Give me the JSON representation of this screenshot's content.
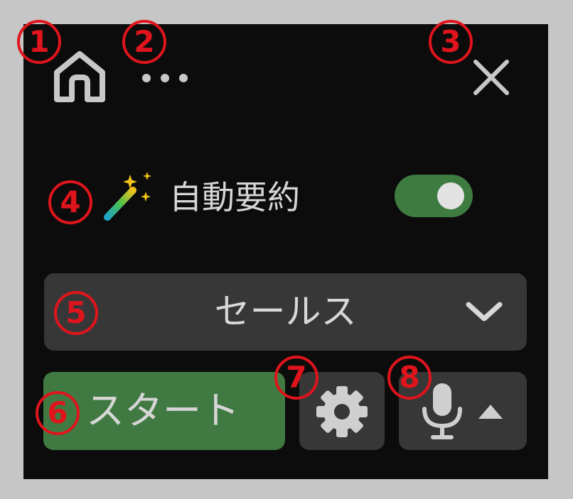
{
  "header": {
    "home_icon": "home-icon",
    "more_icon": "more-horizontal-icon",
    "close_icon": "close-icon"
  },
  "auto_summary": {
    "icon": "magic-wand-icon",
    "label": "自動要約",
    "enabled": true,
    "toggle_color": "#3e7b40"
  },
  "dropdown": {
    "selected": "セールス",
    "icon": "chevron-down-icon"
  },
  "actions": {
    "start_label": "スタート",
    "start_color": "#407a42",
    "settings_icon": "gear-icon",
    "mic_icon": "microphone-icon",
    "mic_menu_icon": "caret-up-icon"
  },
  "annotations": [
    "1",
    "2",
    "3",
    "4",
    "5",
    "6",
    "7",
    "8"
  ],
  "colors": {
    "panel_bg": "#0c0c0c",
    "button_bg": "#373737",
    "annotation_red": "#e0141c"
  }
}
